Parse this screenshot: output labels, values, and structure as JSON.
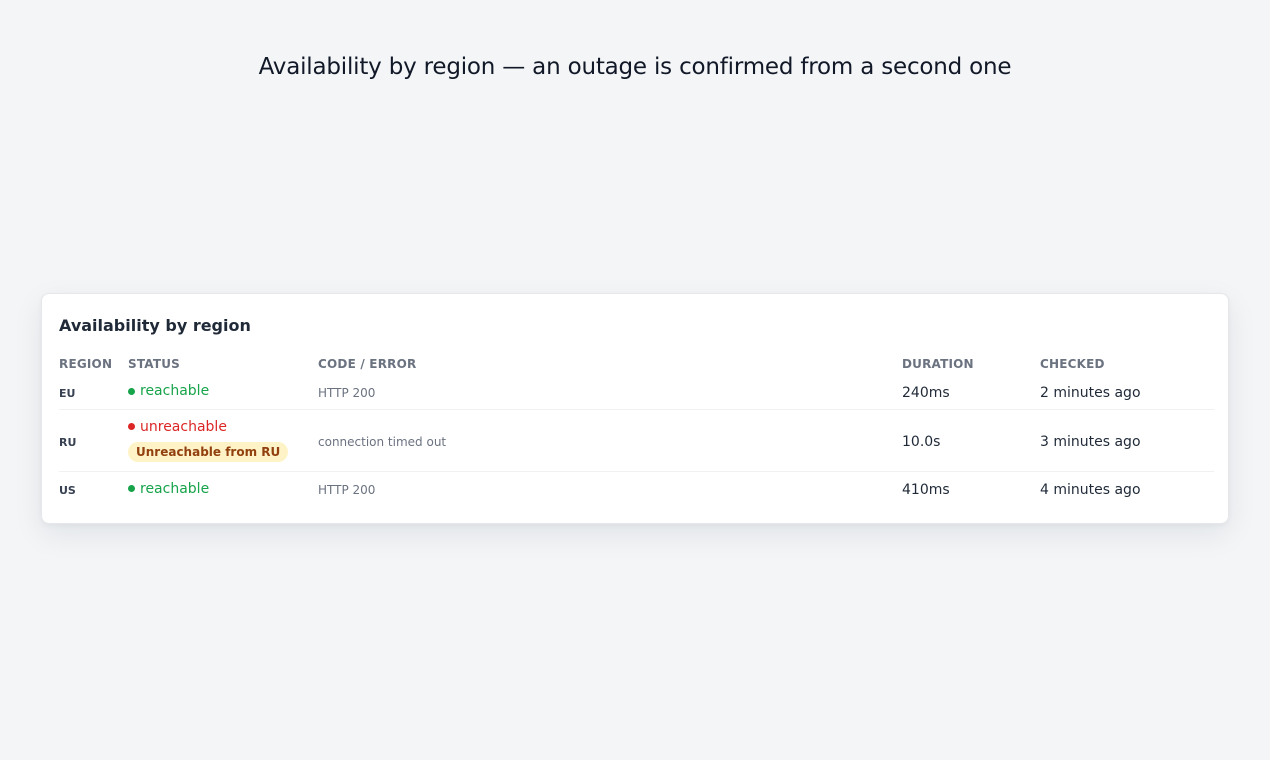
{
  "page": {
    "heading": "Availability by region — an outage is confirmed from a second one"
  },
  "card": {
    "title": "Availability by region",
    "columns": [
      "REGION",
      "STATUS",
      "CODE / ERROR",
      "DURATION",
      "CHECKED"
    ],
    "rows": [
      {
        "region": "EU",
        "status": "reachable",
        "status_kind": "ok",
        "badge": "",
        "code": "HTTP 200",
        "duration": "240ms",
        "checked": "2 minutes ago"
      },
      {
        "region": "RU",
        "status": "unreachable",
        "status_kind": "bad",
        "badge": "Unreachable from RU",
        "code": "connection timed out",
        "duration": "10.0s",
        "checked": "3 minutes ago"
      },
      {
        "region": "US",
        "status": "reachable",
        "status_kind": "ok",
        "badge": "",
        "code": "HTTP 200",
        "duration": "410ms",
        "checked": "4 minutes ago"
      }
    ]
  },
  "colors": {
    "ok": "#16a34a",
    "bad": "#dc2626",
    "badge_bg": "#fef3c7",
    "badge_text": "#92400e"
  }
}
